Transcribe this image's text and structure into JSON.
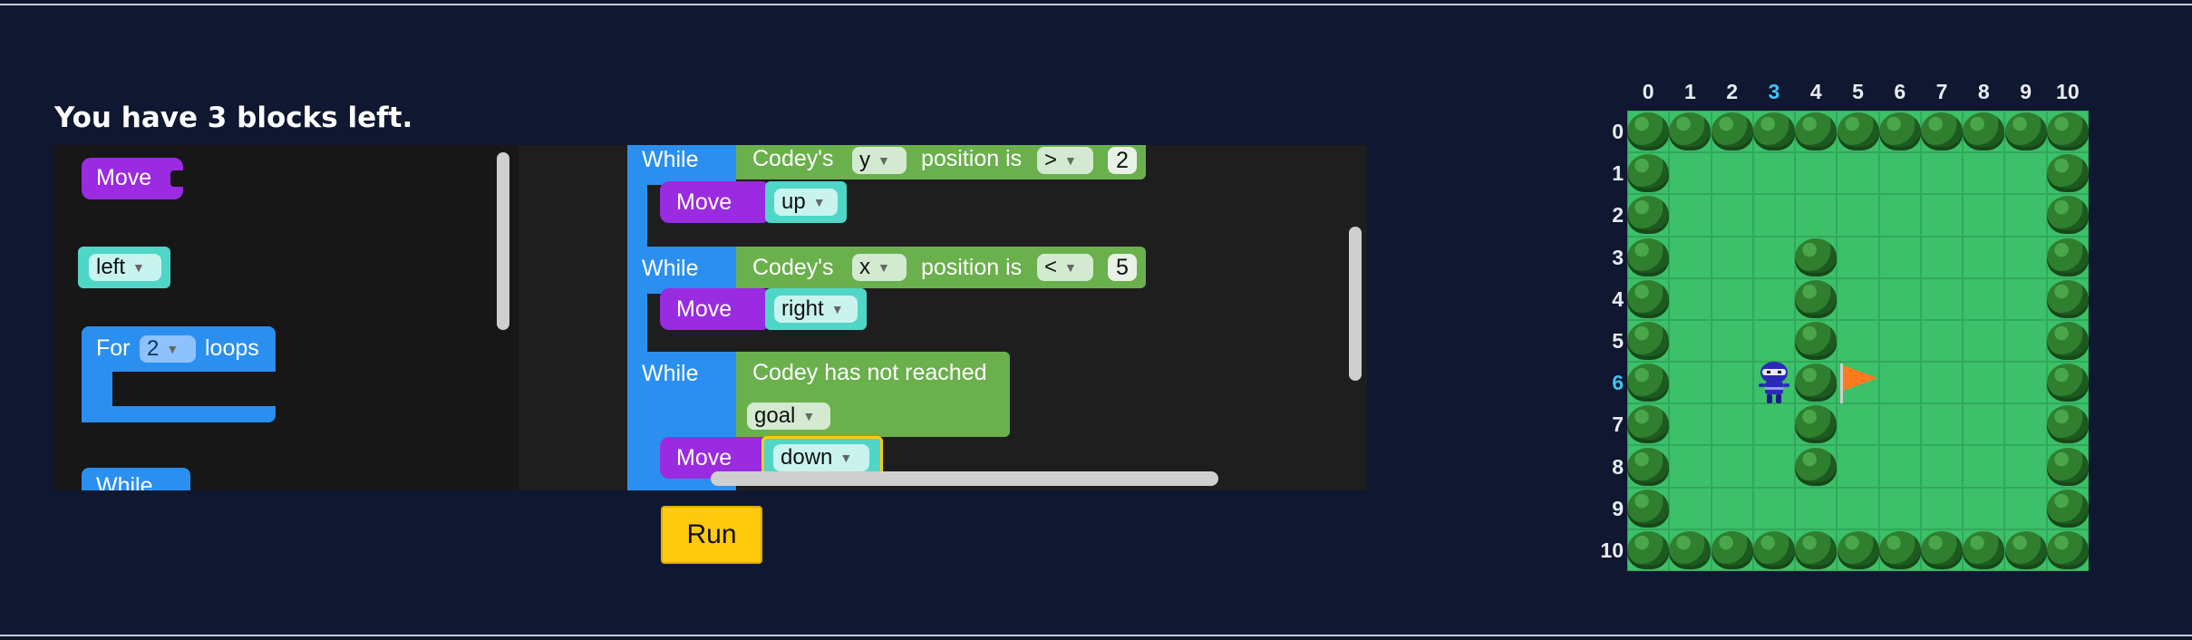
{
  "status": {
    "blocks_left": "You have 3 blocks left."
  },
  "flyout": {
    "move_label": "Move",
    "left_label": "left",
    "for_label": "For",
    "for_count": "2",
    "loops_label": "loops",
    "while_label": "While"
  },
  "program": {
    "while1": {
      "label": "While",
      "codey": "Codey's",
      "axis": "y",
      "position_is": "position is",
      "op": ">",
      "value": "2"
    },
    "move1": {
      "label": "Move",
      "dir": "up"
    },
    "while2": {
      "label": "While",
      "codey": "Codey's",
      "axis": "x",
      "position_is": "position is",
      "op": "<",
      "value": "5"
    },
    "move2": {
      "label": "Move",
      "dir": "right"
    },
    "while3": {
      "label": "While",
      "condition": "Codey has not reached",
      "target": "goal"
    },
    "move3": {
      "label": "Move",
      "dir": "down"
    }
  },
  "controls": {
    "run_label": "Run"
  },
  "game": {
    "x_labels": [
      "0",
      "1",
      "2",
      "3",
      "4",
      "5",
      "6",
      "7",
      "8",
      "9",
      "10"
    ],
    "y_labels": [
      "0",
      "1",
      "2",
      "3",
      "4",
      "5",
      "6",
      "7",
      "8",
      "9",
      "10"
    ],
    "highlight_x": "3",
    "highlight_y": "6",
    "player": {
      "x": 3,
      "y": 6
    },
    "goal": {
      "x": 5,
      "y": 6
    },
    "inner_bushes": [
      [
        4,
        3
      ],
      [
        4,
        4
      ],
      [
        4,
        5
      ],
      [
        4,
        6
      ],
      [
        4,
        7
      ],
      [
        4,
        8
      ]
    ],
    "colors": {
      "grass": "#3cc06a",
      "highlight": "#3fc3f0",
      "flag": "#ff7a1f"
    }
  }
}
